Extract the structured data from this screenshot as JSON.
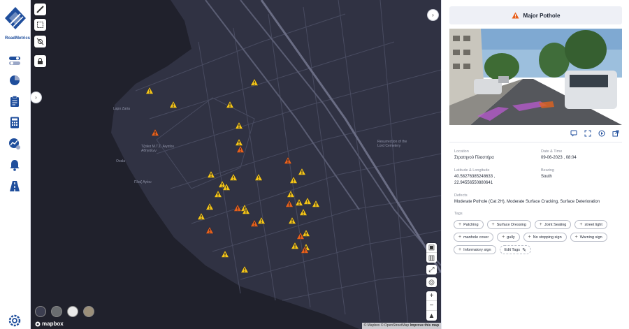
{
  "app": {
    "logo_text": "RoadMetrics"
  },
  "nav": {
    "items": [
      {
        "name": "toggle-icon"
      },
      {
        "name": "pie-chart-icon"
      },
      {
        "name": "clipboard-icon"
      },
      {
        "name": "calculator-icon"
      },
      {
        "name": "analytics-icon"
      },
      {
        "name": "bell-icon"
      },
      {
        "name": "road-icon"
      }
    ],
    "settings_icon": "gear-icon"
  },
  "map": {
    "tools": [
      "ruler-icon",
      "select-area-icon",
      "satellite-icon",
      "lock-icon"
    ],
    "labels": [
      {
        "text": "Lapo Zaria"
      },
      {
        "text": "Τζαίκα Μ.Τ.Σ. Αιγαίου\nΑθηναίων"
      },
      {
        "text": "Ovala"
      },
      {
        "text": "Πλαζ Αγίου"
      },
      {
        "text": "Resurrection of the\nLord Cemetery"
      }
    ],
    "controls_top": [
      "fullscreen-icon",
      "trash-icon"
    ],
    "controls_mid": [
      "expand-icon"
    ],
    "controls_locate": [
      "locate-icon"
    ],
    "zoom": [
      "+",
      "−"
    ],
    "compass": "compass-icon",
    "styles": [
      "dark",
      "streets",
      "light",
      "satellite"
    ],
    "brand": "mapbox",
    "attribution": {
      "a": "© Mapbox",
      "b": "© OpenStreetMap",
      "c": "Improve this map"
    },
    "colors": {
      "warning_yellow": "#f5c518",
      "warning_orange": "#e8601c",
      "background": "#2b2c3a"
    }
  },
  "panel": {
    "title": "Major Pothole",
    "fields": {
      "location_label": "Location",
      "location_value": "Στρατηγού Πλαστήρα",
      "datetime_label": "Date & Time",
      "datetime_value": "09-06-2023 , 08:04",
      "latlng_label": "Latitude & Longitude",
      "lat_value": "40.58276385248633 ,",
      "lng_value": "22.94556550880641",
      "bearing_label": "Bearing",
      "bearing_value": "South",
      "defects_label": "Defects",
      "defects_value": "Moderate Pothole (Cat 2H), Moderate Surface Cracking, Surface Deterioration",
      "tags_label": "Tags"
    },
    "tags": [
      [
        "Patching",
        "Surface Dressing",
        "Joint Sealing",
        "street light"
      ],
      [
        "manhole cover",
        "gully",
        "No stopping sign",
        "Warning sign"
      ],
      [
        "Informatory sign"
      ]
    ],
    "edit_tags": "Edit Tags"
  }
}
